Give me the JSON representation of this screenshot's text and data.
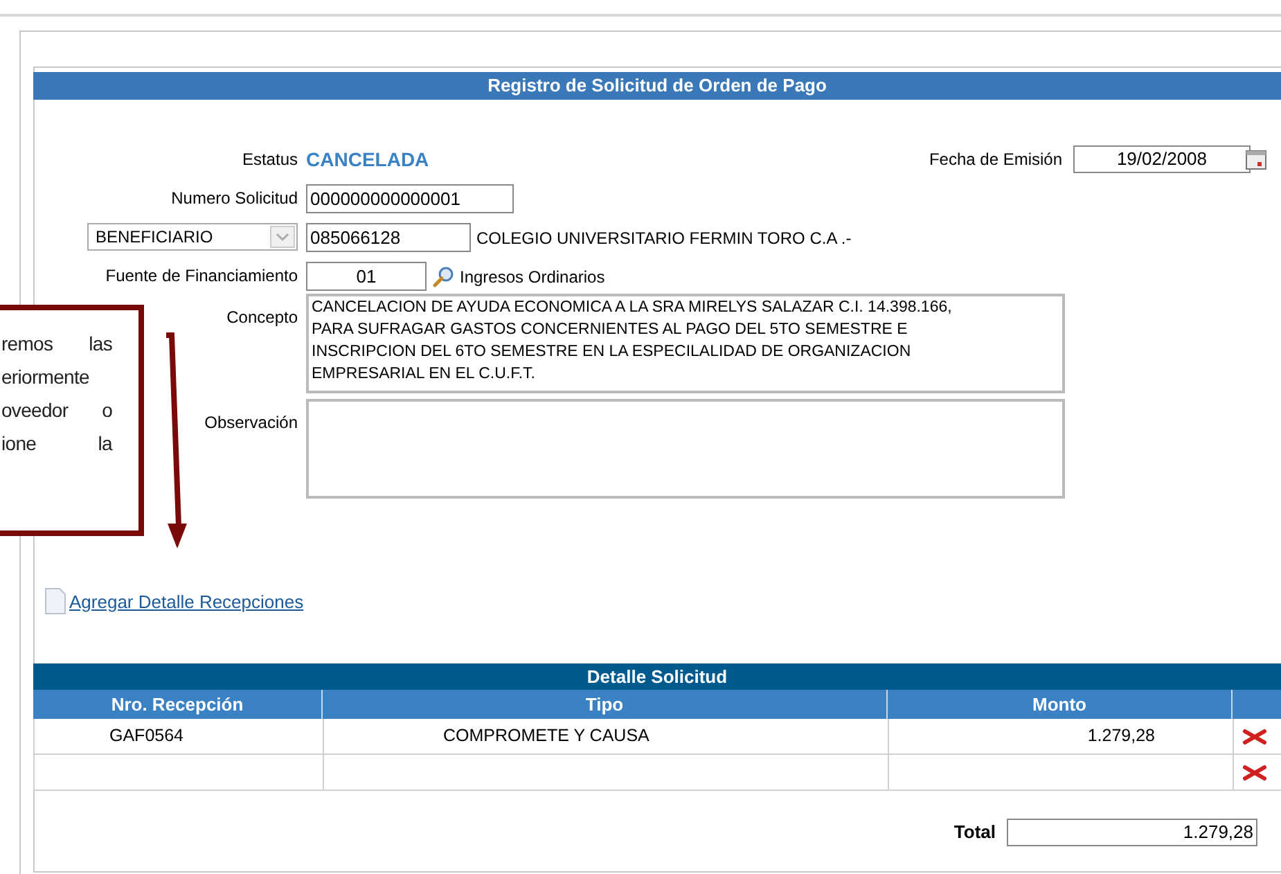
{
  "title": "Registro de Solicitud de Orden de Pago",
  "form": {
    "status_label": "Estatus",
    "status": "CANCELADA",
    "fecha_label": "Fecha de Emisión",
    "fecha": "19/02/2008",
    "numero_label": "Numero Solicitud",
    "numero": "000000000000001",
    "tipo_select": "BENEFICIARIO",
    "beneficiario_id": "085066128",
    "beneficiario_name": "COLEGIO UNIVERSITARIO FERMIN TORO C.A .-",
    "fuente_label": "Fuente de Financiamiento",
    "fuente_code": "01",
    "fuente_name": "Ingresos Ordinarios",
    "concepto_label": "Concepto",
    "concepto": "CANCELACION DE AYUDA ECONOMICA A LA SRA MIRELYS SALAZAR C.I. 14.398.166,\nPARA SUFRAGAR GASTOS CONCERNIENTES AL PAGO DEL 5TO SEMESTRE E\nINSCRIPCION DEL 6TO SEMESTRE EN LA ESPECILALIDAD DE ORGANIZACION\nEMPRESARIAL EN EL C.U.F.T.",
    "observacion_label": "Observación"
  },
  "link": "Agregar Detalle Recepciones",
  "detail": {
    "title": "Detalle Solicitud",
    "columns": [
      "Nro. Recepción",
      "Tipo",
      "Monto"
    ],
    "rows": [
      {
        "recepcion": "GAF0564",
        "tipo": "COMPROMETE Y CAUSA",
        "monto": "1.279,28"
      },
      {}
    ]
  },
  "total_label": "Total",
  "total": "1.279,28",
  "callout": {
    "lines": [
      [
        "remos",
        "las"
      ],
      [
        "eriormente"
      ],
      [
        "oveedor",
        "o"
      ],
      [
        "ione",
        "la"
      ]
    ]
  }
}
